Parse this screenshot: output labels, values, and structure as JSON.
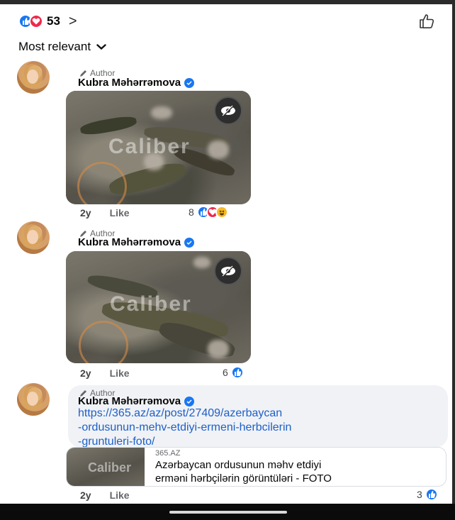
{
  "header": {
    "reaction_count": "53",
    "reaction_icons": [
      "like",
      "love"
    ],
    "chevron": ">",
    "like_icon": "thumbs-up-outline-icon"
  },
  "sort": {
    "label": "Most relevant"
  },
  "comments": [
    {
      "author_tag": "Author",
      "name": "Kubra Məhərrəmova",
      "watermark": "Caliber",
      "time": "2y",
      "like_label": "Like",
      "reaction_count": "8",
      "reactions": [
        "like",
        "love",
        "haha"
      ]
    },
    {
      "author_tag": "Author",
      "name": "Kubra Məhərrəmova",
      "watermark": "Caliber",
      "time": "2y",
      "like_label": "Like",
      "reaction_count": "6",
      "reactions": [
        "like"
      ]
    },
    {
      "author_tag": "Author",
      "name": "Kubra Məhərrəmova",
      "link_lines": [
        "https://365.az/az/post/27409/azerbaycan",
        "-ordusunun-mehv-etdiyi-ermeni-herbcilerin",
        "-gruntuleri-foto/"
      ],
      "preview": {
        "domain": "365.AZ",
        "title_lines": [
          "Azərbaycan ordusunun məhv etdiyi",
          "erməni hərbçilərin görüntüləri - FOTO"
        ],
        "watermark": "Caliber"
      },
      "time": "2y",
      "like_label": "Like",
      "reaction_count": "3",
      "reactions": [
        "like"
      ]
    }
  ],
  "colors": {
    "like_blue": "#1877f2",
    "love_red": "#f0284a",
    "haha_yellow": "#f7b928",
    "link_blue": "#1d5fc9"
  }
}
